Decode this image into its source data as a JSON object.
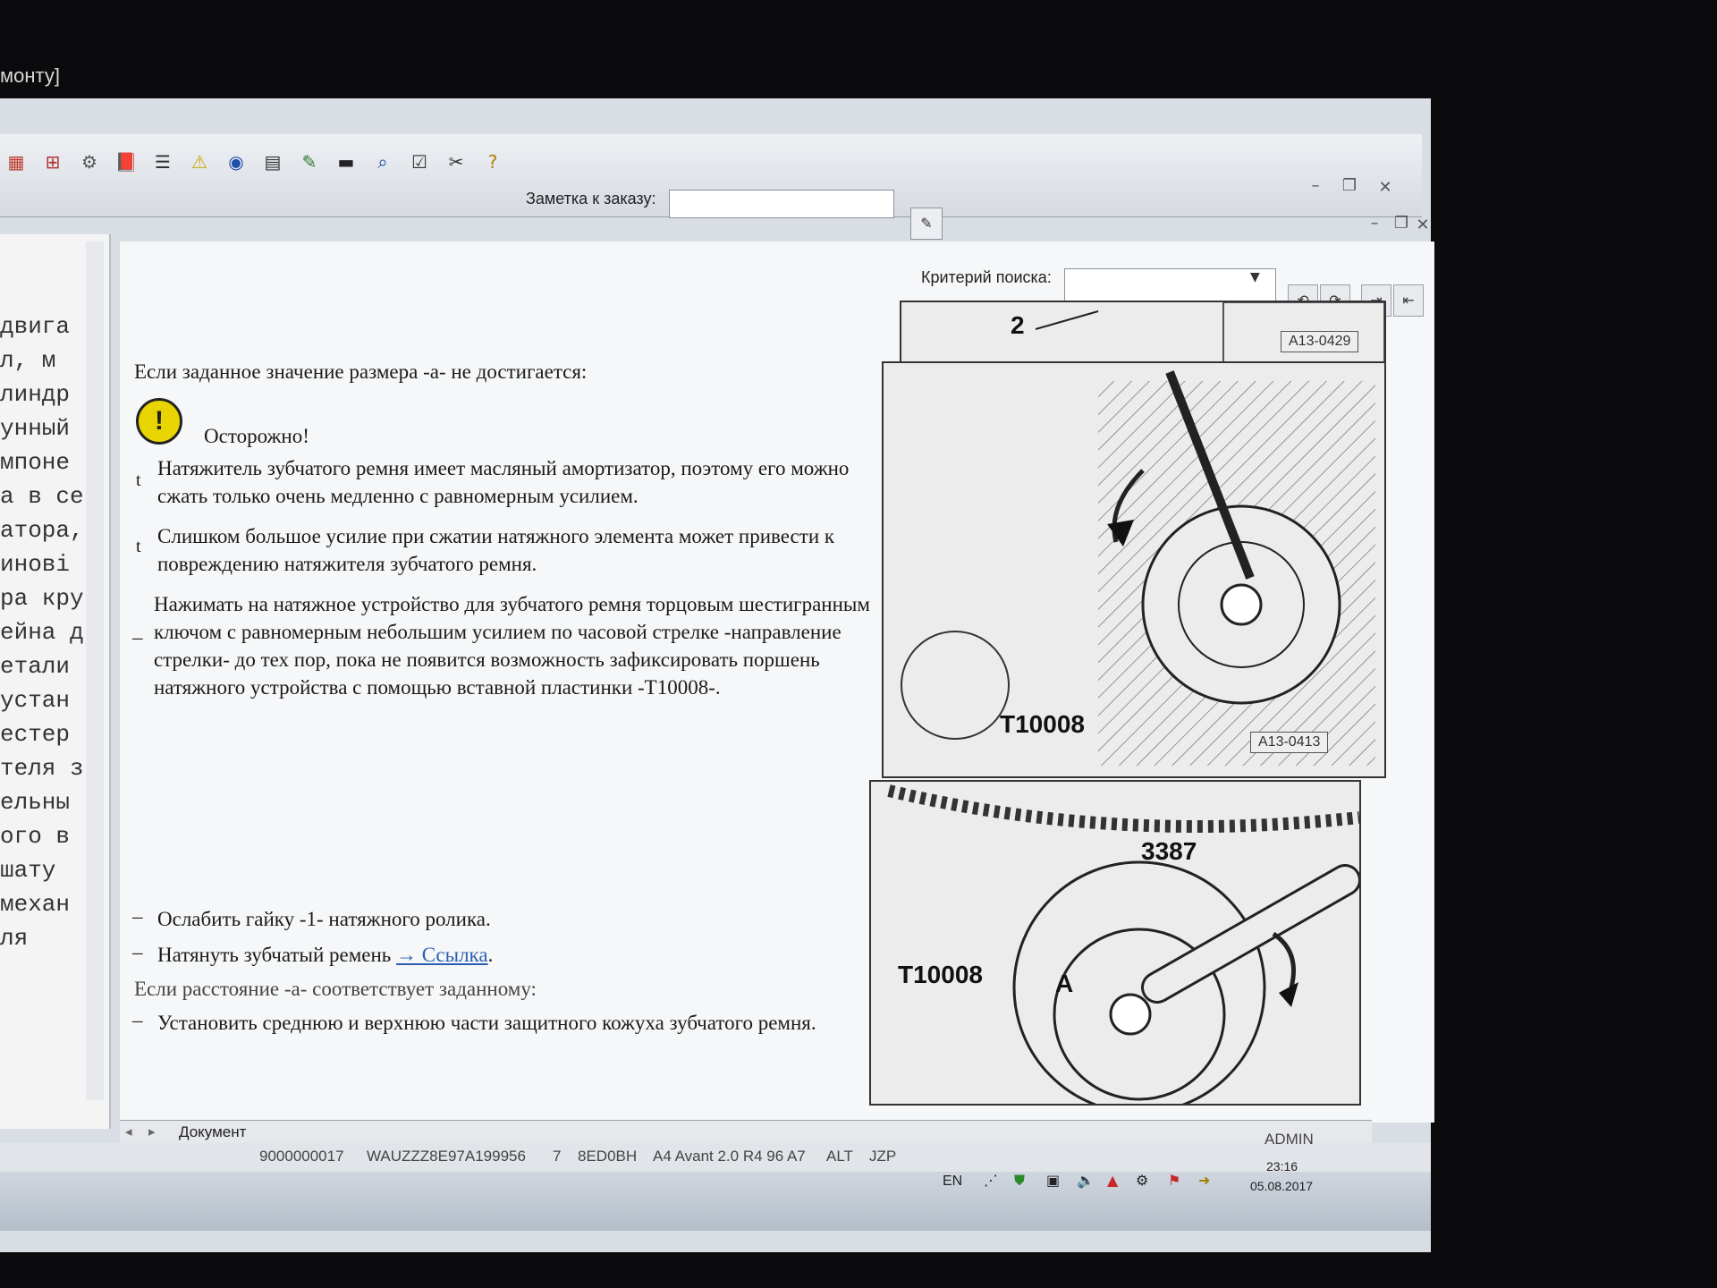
{
  "window": {
    "title_fragment": "монту]"
  },
  "toolbar": {
    "icons": [
      "book-icon",
      "grid-icon",
      "tools-icon",
      "manual-icon",
      "list-icon",
      "warning-icon",
      "globe-icon",
      "save-icon",
      "pen-icon",
      "car-icon",
      "car-search-icon",
      "checklist-icon",
      "tools-edit-icon",
      "help-icon"
    ],
    "note_label": "Заметка к заказу:",
    "note_value": ""
  },
  "left_pane": {
    "lines": [
      "двига",
      "л, м",
      "линдр",
      "унный",
      "мпоне",
      "а в се",
      "атора,",
      "инові",
      "ра кру",
      "ейна д",
      "етали",
      "устан",
      "естер",
      "теля з",
      "ельны",
      "ого в",
      "шату",
      "механ",
      "ля"
    ]
  },
  "search": {
    "label": "Критерий поиска:",
    "value": ""
  },
  "document": {
    "heading_condition": "Если заданное значение размера -a- не достигается:",
    "warning_title": "Осторожно!",
    "bullet_marker": "t",
    "bullet1": "Натяжитель зубчатого ремня имеет масляный амортизатор, поэтому его можно сжать только очень медленно с равномерным усилием.",
    "bullet2": "Слишком большое усилие при сжатии натяжного элемента может привести к повреждению натяжителя зубчатого ремня.",
    "step_press": "Нажимать на натяжное устройство для зубчатого ремня торцовым шестигранным ключом с равномерным небольшим усилием по часовой стрелке -направление стрелки- до тех пор, пока не появится возможность зафиксировать поршень натяжного устройства с помощью вставной пластинки -T10008-.",
    "step_loosen": "Ослабить гайку -1- натяжного ролика.",
    "step_tension_prefix": "Натянуть зубчатый ремень",
    "step_tension_link": "→ Ссылка",
    "step_tension_suffix": ".",
    "condition2": "Если расстояние -a- соответствует заданному:",
    "step_install": "Установить среднюю и верхнюю части защитного кожуха зубчатого ремня.",
    "dash": "–"
  },
  "figures": {
    "fig1_label": "2",
    "fig1_code": "A13-0429",
    "fig2_tool": "T10008",
    "fig2_code": "A13-0413",
    "fig3_tool1": "3387",
    "fig3_tool2": "T10008",
    "fig3_mark": "A"
  },
  "tabs": {
    "document": "Документ"
  },
  "status": {
    "order": "9000000017",
    "vin": "WAUZZZ8E97A199956",
    "num": "7",
    "code": "8ED0BH",
    "model": "A4 Avant 2.0 R4 96 A7",
    "engine": "ALT",
    "trans": "JZP",
    "user": "ADMIN"
  },
  "tray": {
    "lang": "EN",
    "time": "23:16",
    "date": "05.08.2017"
  }
}
